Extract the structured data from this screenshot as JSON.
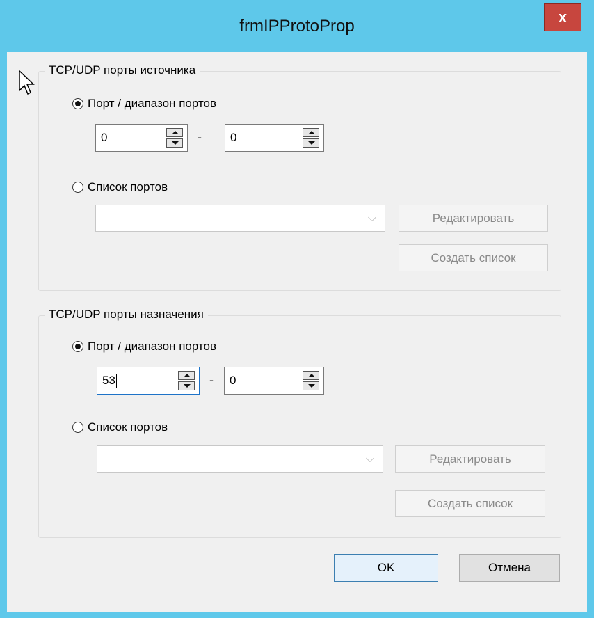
{
  "window": {
    "title": "frmIPProtoProp",
    "close_glyph": "x",
    "frame_color": "#5ec8ea",
    "close_color": "#c7463e"
  },
  "source_group": {
    "title": "TCP/UDP порты источника",
    "radio_range_label": "Порт / диапазон портов",
    "radio_range_checked": true,
    "range_from": "0",
    "range_separator": "-",
    "range_to": "0",
    "radio_list_label": "Список портов",
    "radio_list_checked": false,
    "list_value": "",
    "edit_button": "Редактировать",
    "create_button": "Создать список"
  },
  "dest_group": {
    "title": "TCP/UDP порты назначения",
    "radio_range_label": "Порт / диапазон портов",
    "radio_range_checked": true,
    "range_from": "53",
    "range_separator": "-",
    "range_to": "0",
    "radio_list_label": "Список портов",
    "radio_list_checked": false,
    "list_value": "",
    "edit_button": "Редактировать",
    "create_button": "Создать список"
  },
  "footer": {
    "ok_label": "OK",
    "cancel_label": "Отмена"
  },
  "icons": {
    "cursor": "mouse-pointer-icon",
    "combo_arrow": "chevron-down-icon",
    "spin_up": "spin-up-icon",
    "spin_down": "spin-down-icon"
  }
}
